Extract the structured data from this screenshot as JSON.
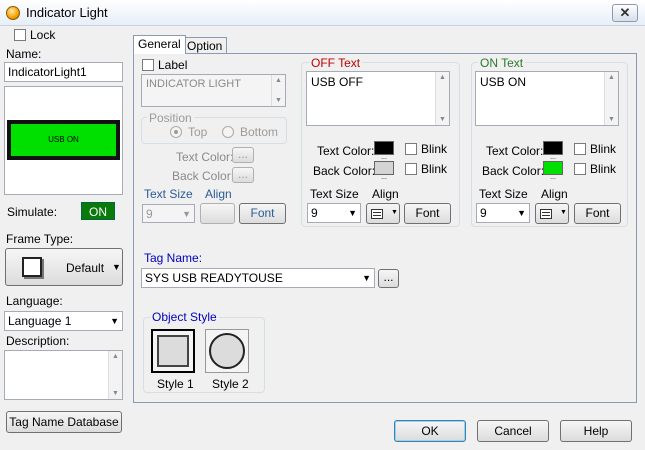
{
  "window": {
    "title": "Indicator Light",
    "close_glyph": "✕"
  },
  "left": {
    "lock_label": "Lock",
    "name_label": "Name:",
    "name_value": "IndicatorLight1",
    "preview_text": "USB ON",
    "simulate_label": "Simulate:",
    "simulate_value": "ON",
    "frame_type_label": "Frame Type:",
    "frame_type_value": "Default",
    "language_label": "Language:",
    "language_value": "Language 1",
    "description_label": "Description:",
    "tag_db_button": "Tag Name Database"
  },
  "tabs": [
    {
      "label": "General"
    },
    {
      "label": "Option"
    }
  ],
  "general": {
    "label_check": "Label",
    "label_text": "INDICATOR LIGHT",
    "position_label": "Position",
    "position_top": "Top",
    "position_bottom": "Bottom",
    "text_color_label": "Text Color:",
    "back_color_label": "Back Color:",
    "ellipsis": "...",
    "text_size_label": "Text Size",
    "align_label": "Align",
    "size_value": "9",
    "font_button": "Font",
    "off": {
      "title": "OFF Text",
      "text": "USB OFF",
      "text_color_label": "Text Color:",
      "back_color_label": "Back Color:",
      "blink1": "Blink",
      "blink2": "Blink",
      "text_size_label": "Text Size",
      "align_label": "Align",
      "size_value": "9",
      "font_button": "Font",
      "text_color": "#000000",
      "back_color": "#d4d4d4"
    },
    "on": {
      "title": "ON Text",
      "text": "USB ON",
      "text_color_label": "Text Color:",
      "back_color_label": "Back Color:",
      "blink1": "Blink",
      "blink2": "Blink",
      "text_size_label": "Text Size",
      "align_label": "Align",
      "size_value": "9",
      "font_button": "Font",
      "text_color": "#000000",
      "back_color": "#00e000"
    },
    "tag_name_label": "Tag Name:",
    "tag_name_value": "SYS USB READYTOUSE",
    "object_style_label": "Object Style",
    "style1": "Style 1",
    "style2": "Style 2"
  },
  "footer": {
    "ok": "OK",
    "cancel": "Cancel",
    "help": "Help"
  },
  "colors": {
    "off_title": "#c00000",
    "on_title": "#2a7a2a",
    "accent_blue": "#0000c0",
    "indicator_green": "#00e000"
  }
}
